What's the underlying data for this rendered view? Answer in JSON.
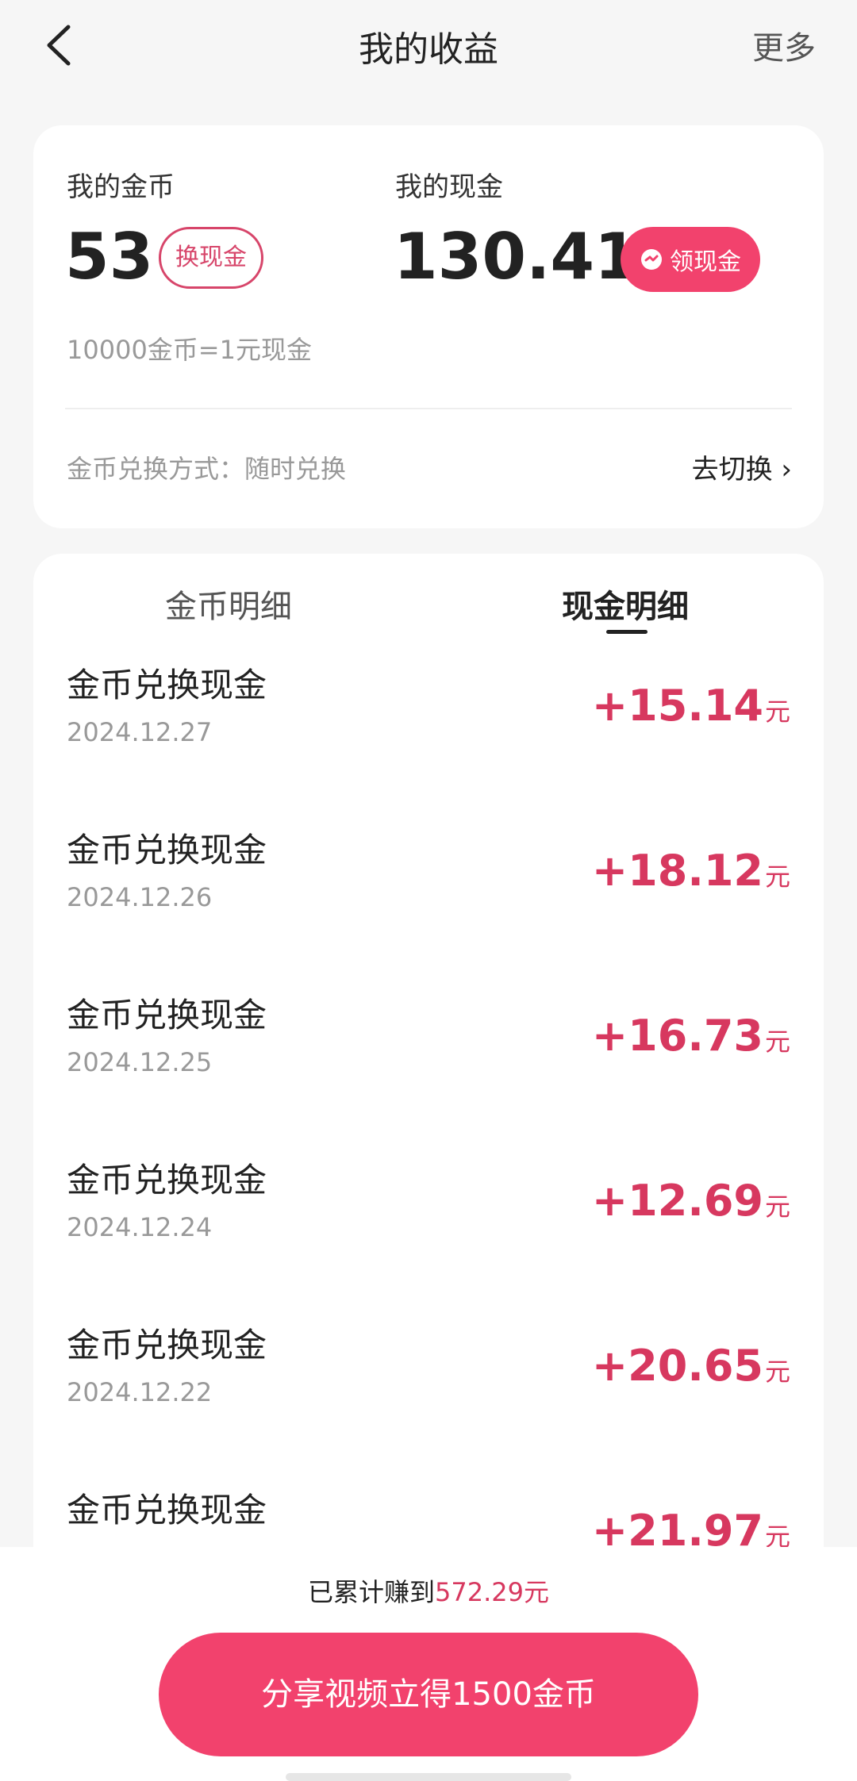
{
  "header": {
    "title": "我的收益",
    "more": "更多"
  },
  "summary": {
    "coin_label": "我的金币",
    "coin_value": "53",
    "exchange_button": "换现金",
    "cash_label": "我的现金",
    "cash_value": "130.41",
    "claim_button": "领现金",
    "rate": "10000金币=1元现金",
    "method": "金币兑换方式：随时兑换",
    "switch": "去切换 ›"
  },
  "tabs": [
    {
      "label": "金币明细",
      "active": false
    },
    {
      "label": "现金明细",
      "active": true
    }
  ],
  "records": [
    {
      "title": "金币兑换现金",
      "date": "2024.12.27",
      "amount": "+15.14",
      "unit": "元"
    },
    {
      "title": "金币兑换现金",
      "date": "2024.12.26",
      "amount": "+18.12",
      "unit": "元"
    },
    {
      "title": "金币兑换现金",
      "date": "2024.12.25",
      "amount": "+16.73",
      "unit": "元"
    },
    {
      "title": "金币兑换现金",
      "date": "2024.12.24",
      "amount": "+12.69",
      "unit": "元"
    },
    {
      "title": "金币兑换现金",
      "date": "2024.12.22",
      "amount": "+20.65",
      "unit": "元"
    },
    {
      "title": "金币兑换现金",
      "date": "",
      "amount": "+21.97",
      "unit": "元"
    }
  ],
  "footer": {
    "earned_prefix": "已累计赚到",
    "earned_amount": "572.29元",
    "share_button": "分享视频立得1500金币"
  },
  "colors": {
    "accent": "#f2426d",
    "amount": "#d7385f",
    "background": "#f6f6f6"
  }
}
